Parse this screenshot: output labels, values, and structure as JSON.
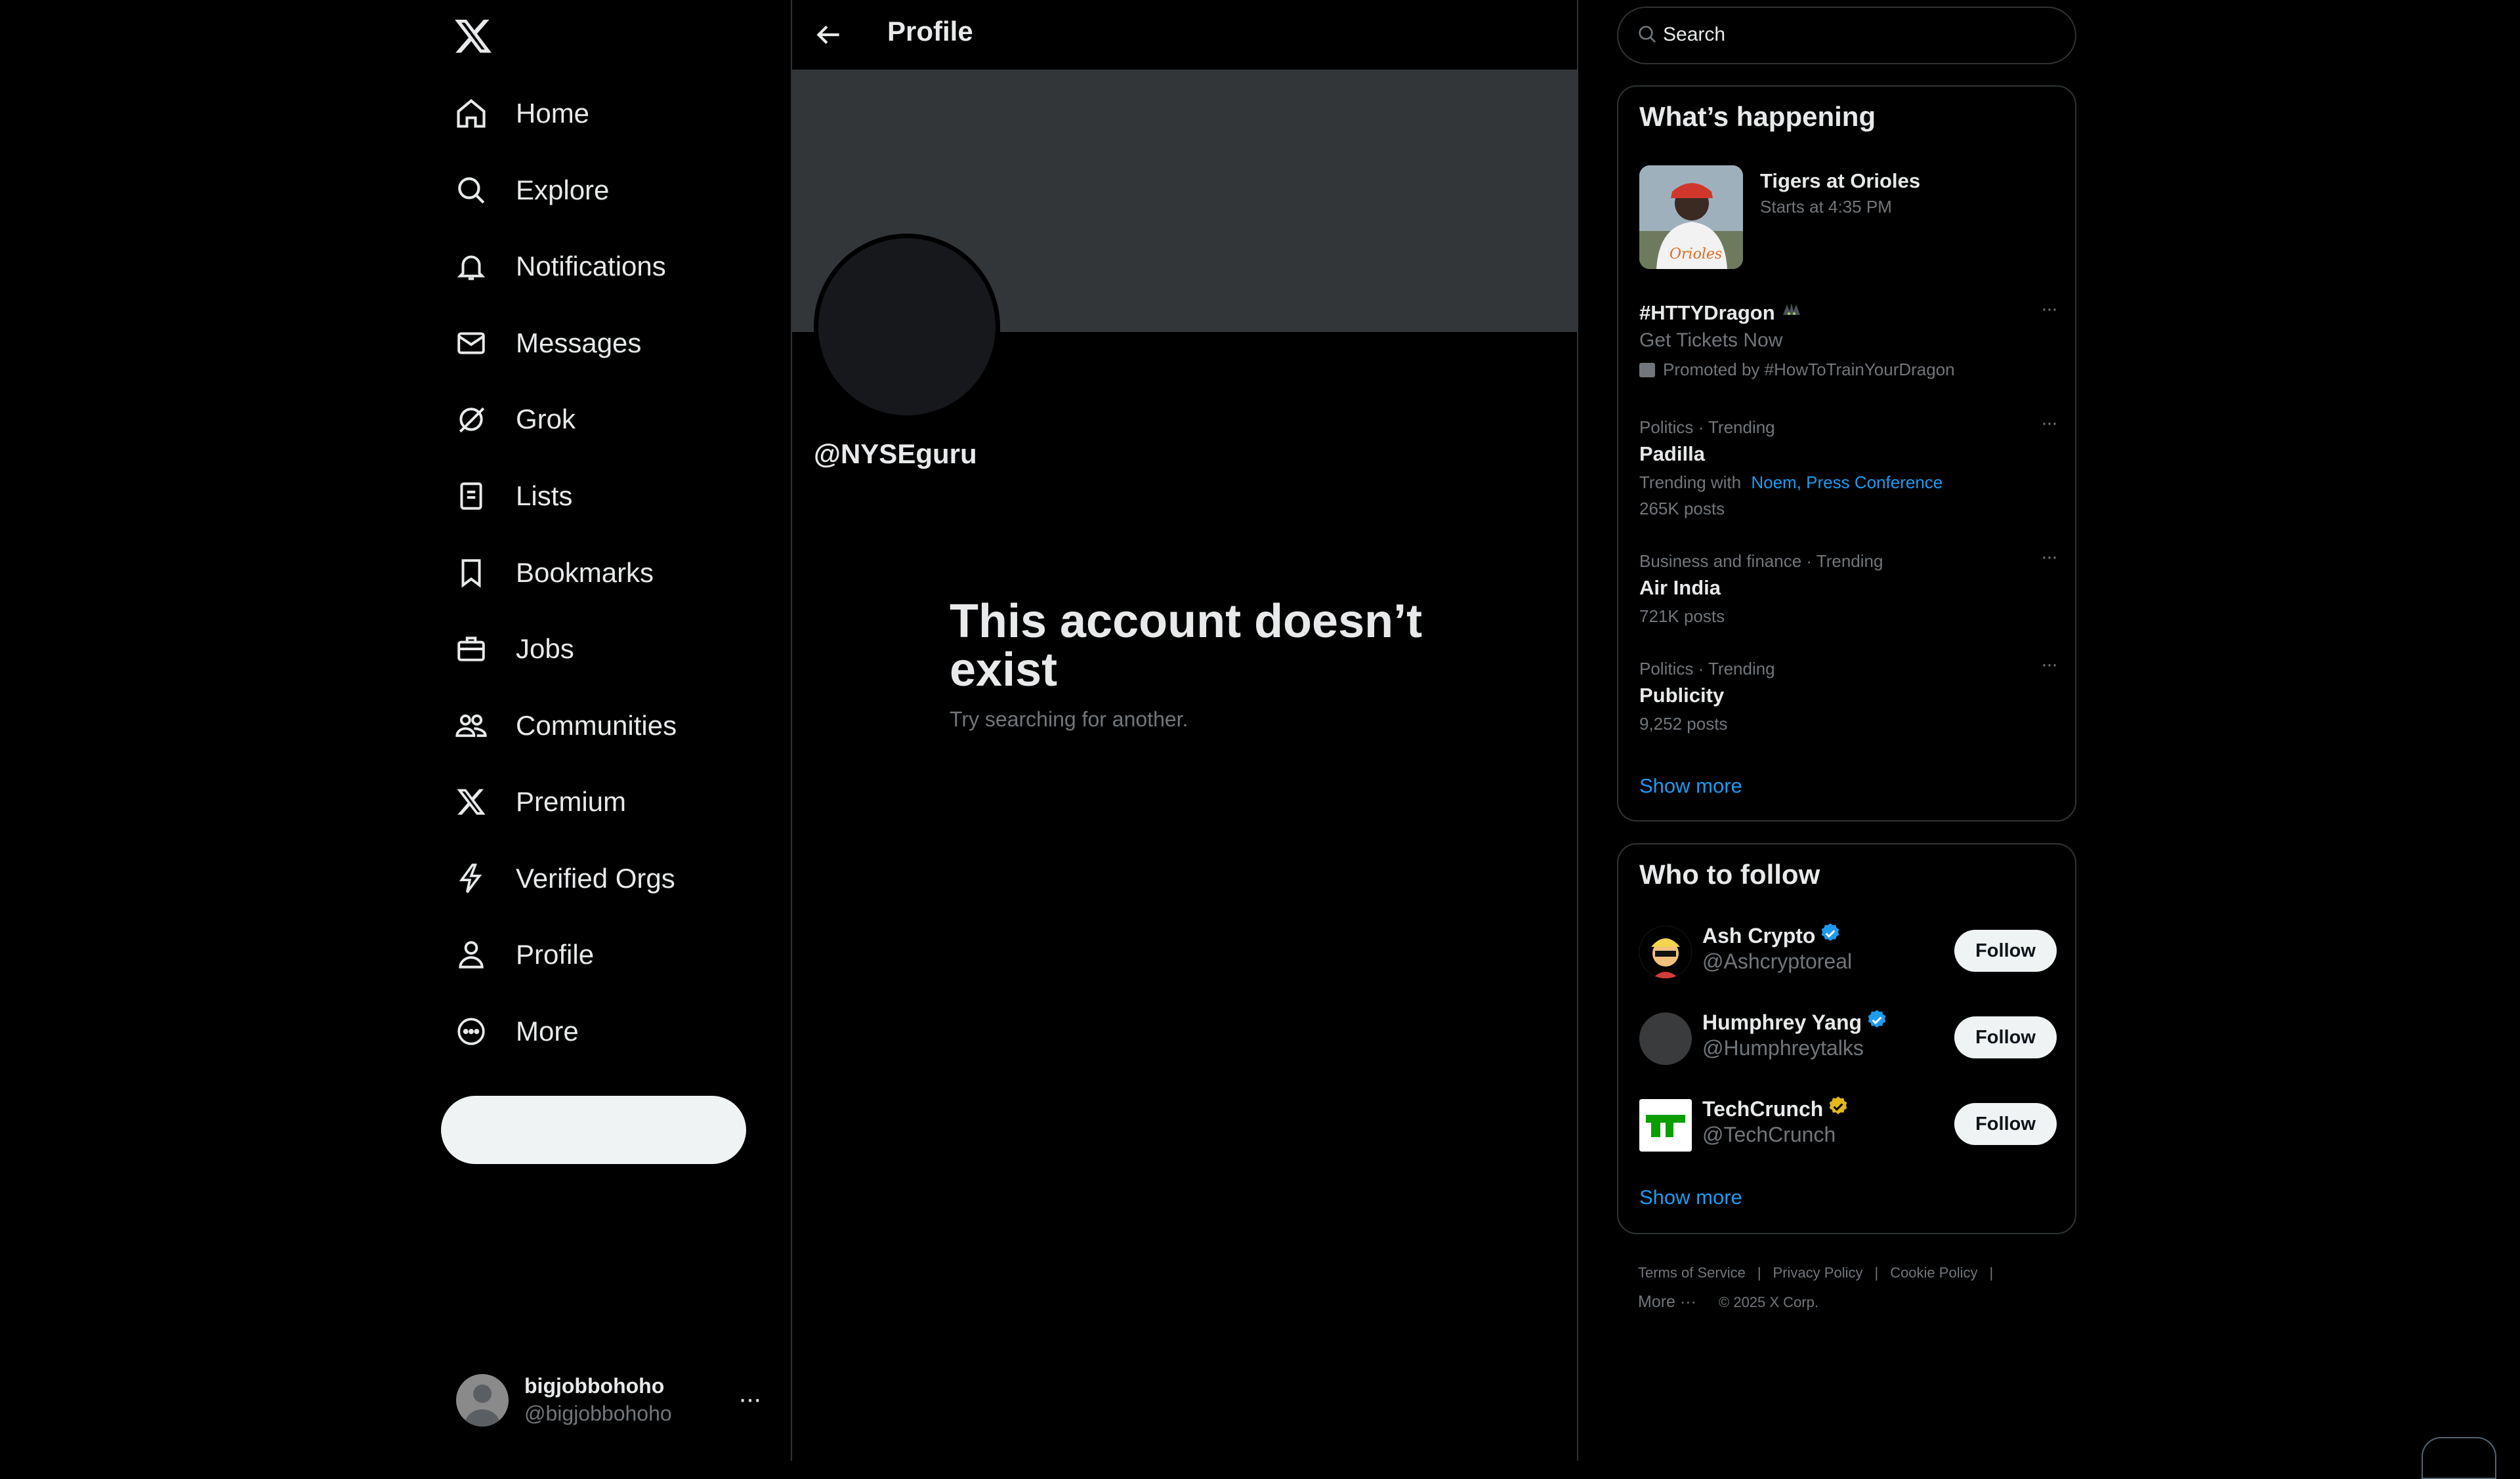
{
  "nav": {
    "items": [
      {
        "label": "Home",
        "icon": "home-icon"
      },
      {
        "label": "Explore",
        "icon": "search-icon"
      },
      {
        "label": "Notifications",
        "icon": "bell-icon"
      },
      {
        "label": "Messages",
        "icon": "envelope-icon"
      },
      {
        "label": "Grok",
        "icon": "grok-icon"
      },
      {
        "label": "Lists",
        "icon": "list-icon"
      },
      {
        "label": "Bookmarks",
        "icon": "bookmark-icon"
      },
      {
        "label": "Jobs",
        "icon": "briefcase-icon"
      },
      {
        "label": "Communities",
        "icon": "people-icon"
      },
      {
        "label": "Premium",
        "icon": "x-logo-icon"
      },
      {
        "label": "Verified Orgs",
        "icon": "lightning-icon"
      },
      {
        "label": "Profile",
        "icon": "person-icon"
      },
      {
        "label": "More",
        "icon": "more-circle-icon"
      }
    ],
    "post_label": ""
  },
  "account": {
    "name": "bigjobbohoho",
    "handle": "@bigjobbohoho"
  },
  "center": {
    "title": "Profile",
    "handle": "@NYSEguru",
    "empty_title": "This account doesn’t exist",
    "empty_sub": "Try searching for another."
  },
  "search": {
    "placeholder": "Search"
  },
  "whats_happening": {
    "title": "What’s happening",
    "event": {
      "title": "Tigers at Orioles",
      "time": "Starts at 4:35 PM"
    },
    "promo": {
      "tag": "#HTTYDragon",
      "sub": "Get Tickets Now",
      "by": "Promoted by #HowToTrainYourDragon"
    },
    "trends": [
      {
        "context": "Politics · Trending",
        "name": "Padilla",
        "with_prefix": "Trending with",
        "with_links": "Noem, Press Conference",
        "posts": "265K posts"
      },
      {
        "context": "Business and finance · Trending",
        "name": "Air India",
        "posts": "721K posts"
      },
      {
        "context": "Politics · Trending",
        "name": "Publicity",
        "posts": "9,252 posts"
      }
    ],
    "show_more": "Show more"
  },
  "who_to_follow": {
    "title": "Who to follow",
    "users": [
      {
        "name": "Ash Crypto",
        "handle": "@Ashcryptoreal",
        "badge": "blue",
        "button": "Follow"
      },
      {
        "name": "Humphrey Yang",
        "handle": "@Humphreytalks",
        "badge": "blue",
        "button": "Follow"
      },
      {
        "name": "TechCrunch",
        "handle": "@TechCrunch",
        "badge": "gold",
        "button": "Follow"
      }
    ],
    "show_more": "Show more"
  },
  "footer": {
    "links": [
      "Terms of Service",
      "Privacy Policy",
      "Cookie Policy"
    ],
    "more": "More ···",
    "copyright": "© 2025 X Corp."
  },
  "colors": {
    "accent": "#1d9bf0",
    "verified_blue": "#1d9bf0",
    "verified_gold": "#e2b719",
    "background": "#000000"
  }
}
